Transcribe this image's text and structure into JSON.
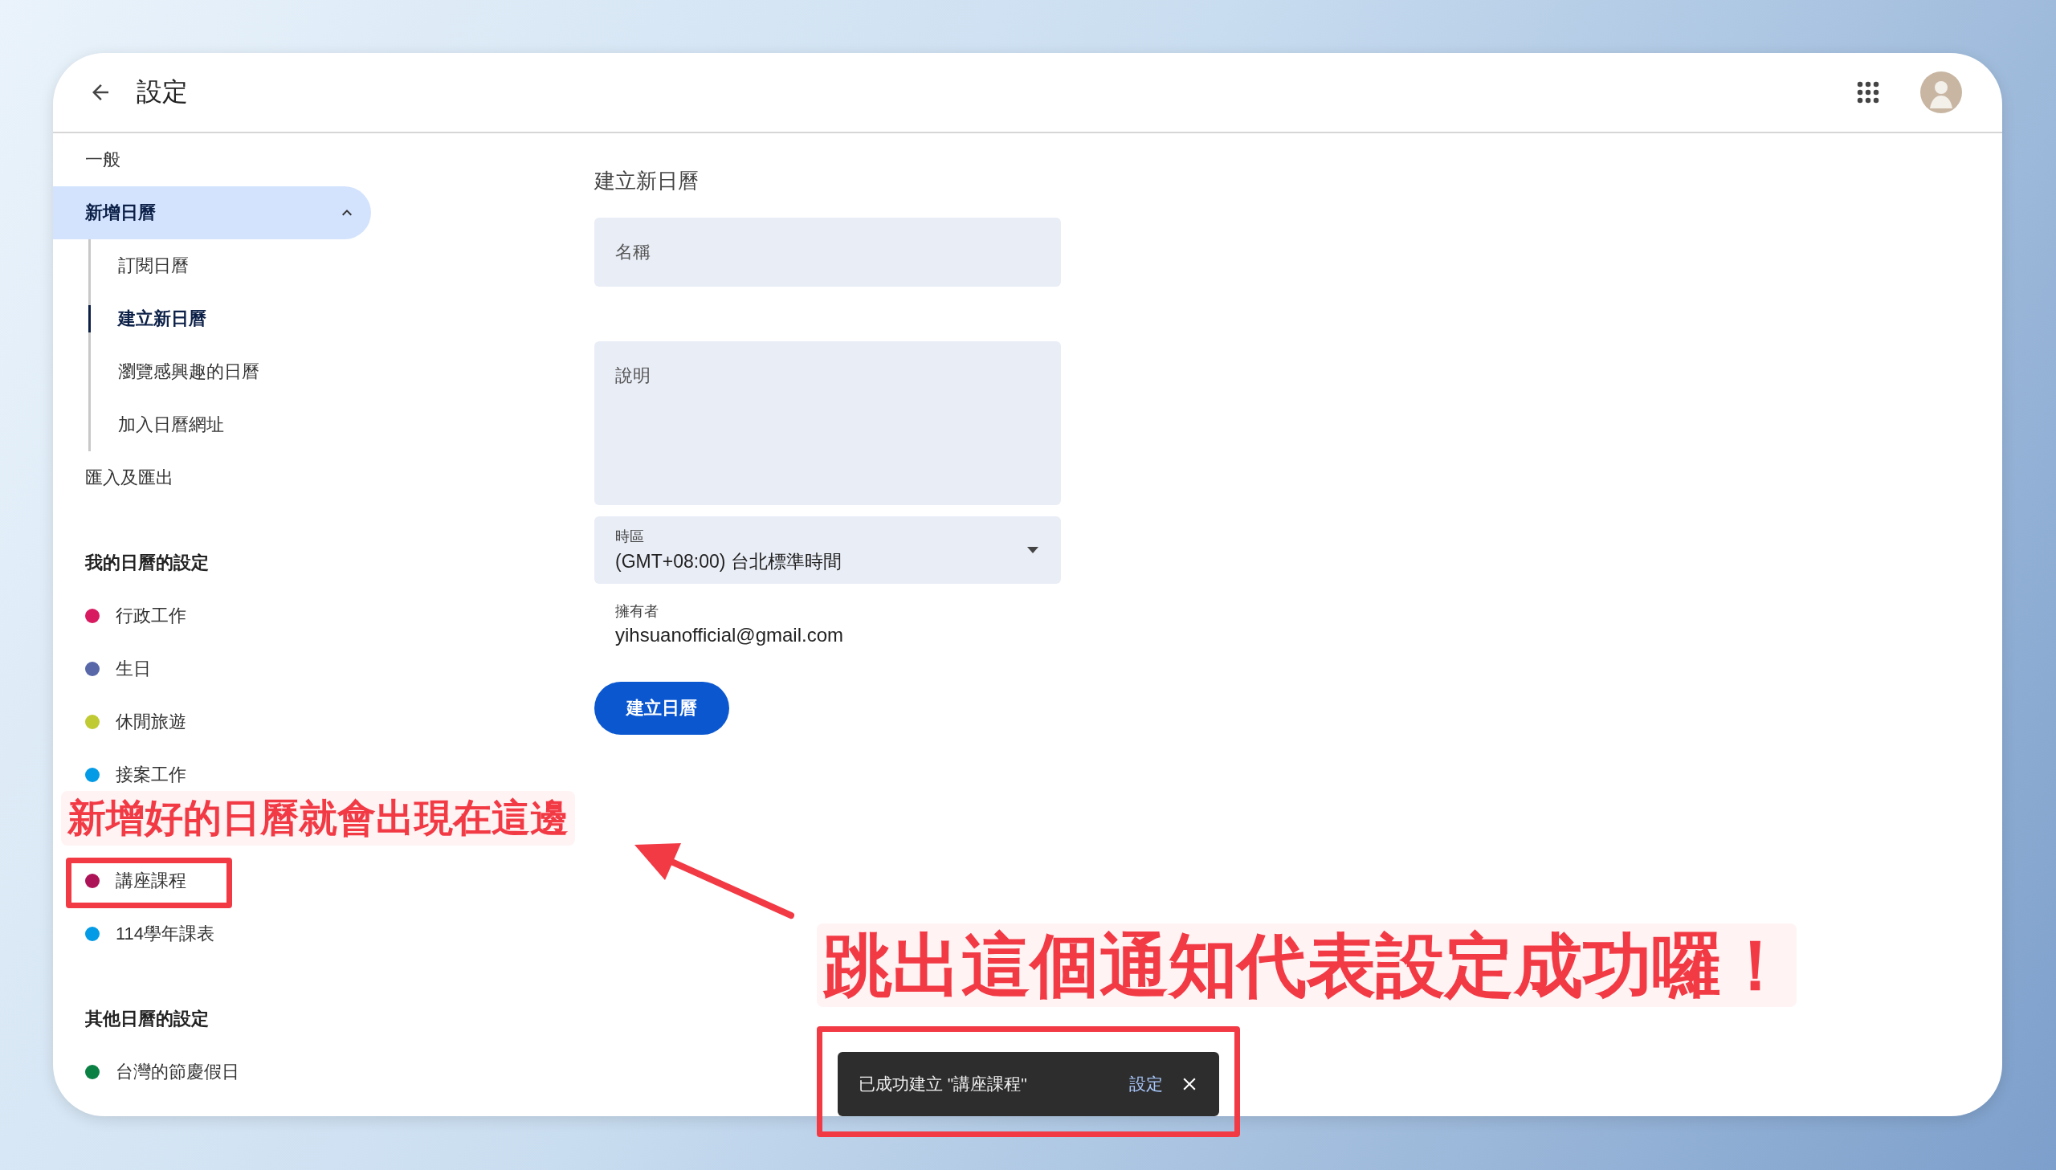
{
  "header": {
    "title": "設定"
  },
  "sidebar": {
    "items": [
      {
        "label": "一般",
        "selected": false,
        "expanded": false
      },
      {
        "label": "新增日曆",
        "selected": true,
        "expanded": true,
        "children": [
          {
            "label": "訂閱日曆",
            "selected": false
          },
          {
            "label": "建立新日曆",
            "selected": true
          },
          {
            "label": "瀏覽感興趣的日曆",
            "selected": false
          },
          {
            "label": "加入日曆網址",
            "selected": false
          }
        ]
      },
      {
        "label": "匯入及匯出",
        "selected": false,
        "expanded": false
      }
    ],
    "sections": [
      {
        "title": "我的日曆的設定",
        "calendars": [
          {
            "name": "行政工作",
            "color": "#d81b60"
          },
          {
            "name": "生日",
            "color": "#5767a8"
          },
          {
            "name": "休閒旅遊",
            "color": "#c0ca33"
          },
          {
            "name": "接案工作",
            "color": "#039be5"
          },
          {
            "name": "講座課程",
            "color": "#ad1457"
          },
          {
            "name": "114學年課表",
            "color": "#039be5"
          }
        ]
      },
      {
        "title": "其他日曆的設定",
        "calendars": [
          {
            "name": "台灣的節慶假日",
            "color": "#0b8043"
          }
        ]
      }
    ]
  },
  "form": {
    "title": "建立新日曆",
    "name_field": {
      "placeholder": "名稱"
    },
    "description_field": {
      "placeholder": "說明"
    },
    "timezone": {
      "label": "時區",
      "value": "(GMT+08:00) 台北標準時間"
    },
    "owner": {
      "label": "擁有者",
      "value": "yihsuanofficial@gmail.com"
    },
    "submit_button": "建立日曆"
  },
  "snackbar": {
    "message": "已成功建立 \"講座課程\"",
    "action": "設定"
  },
  "annotations": [
    {
      "kind": "caption",
      "text": "新增好的日曆就會出現在這邊"
    },
    {
      "kind": "caption",
      "text": "跳出這個通知代表設定成功囉！"
    },
    {
      "kind": "highlight-box"
    },
    {
      "kind": "highlight-box"
    },
    {
      "kind": "arrow"
    }
  ]
}
